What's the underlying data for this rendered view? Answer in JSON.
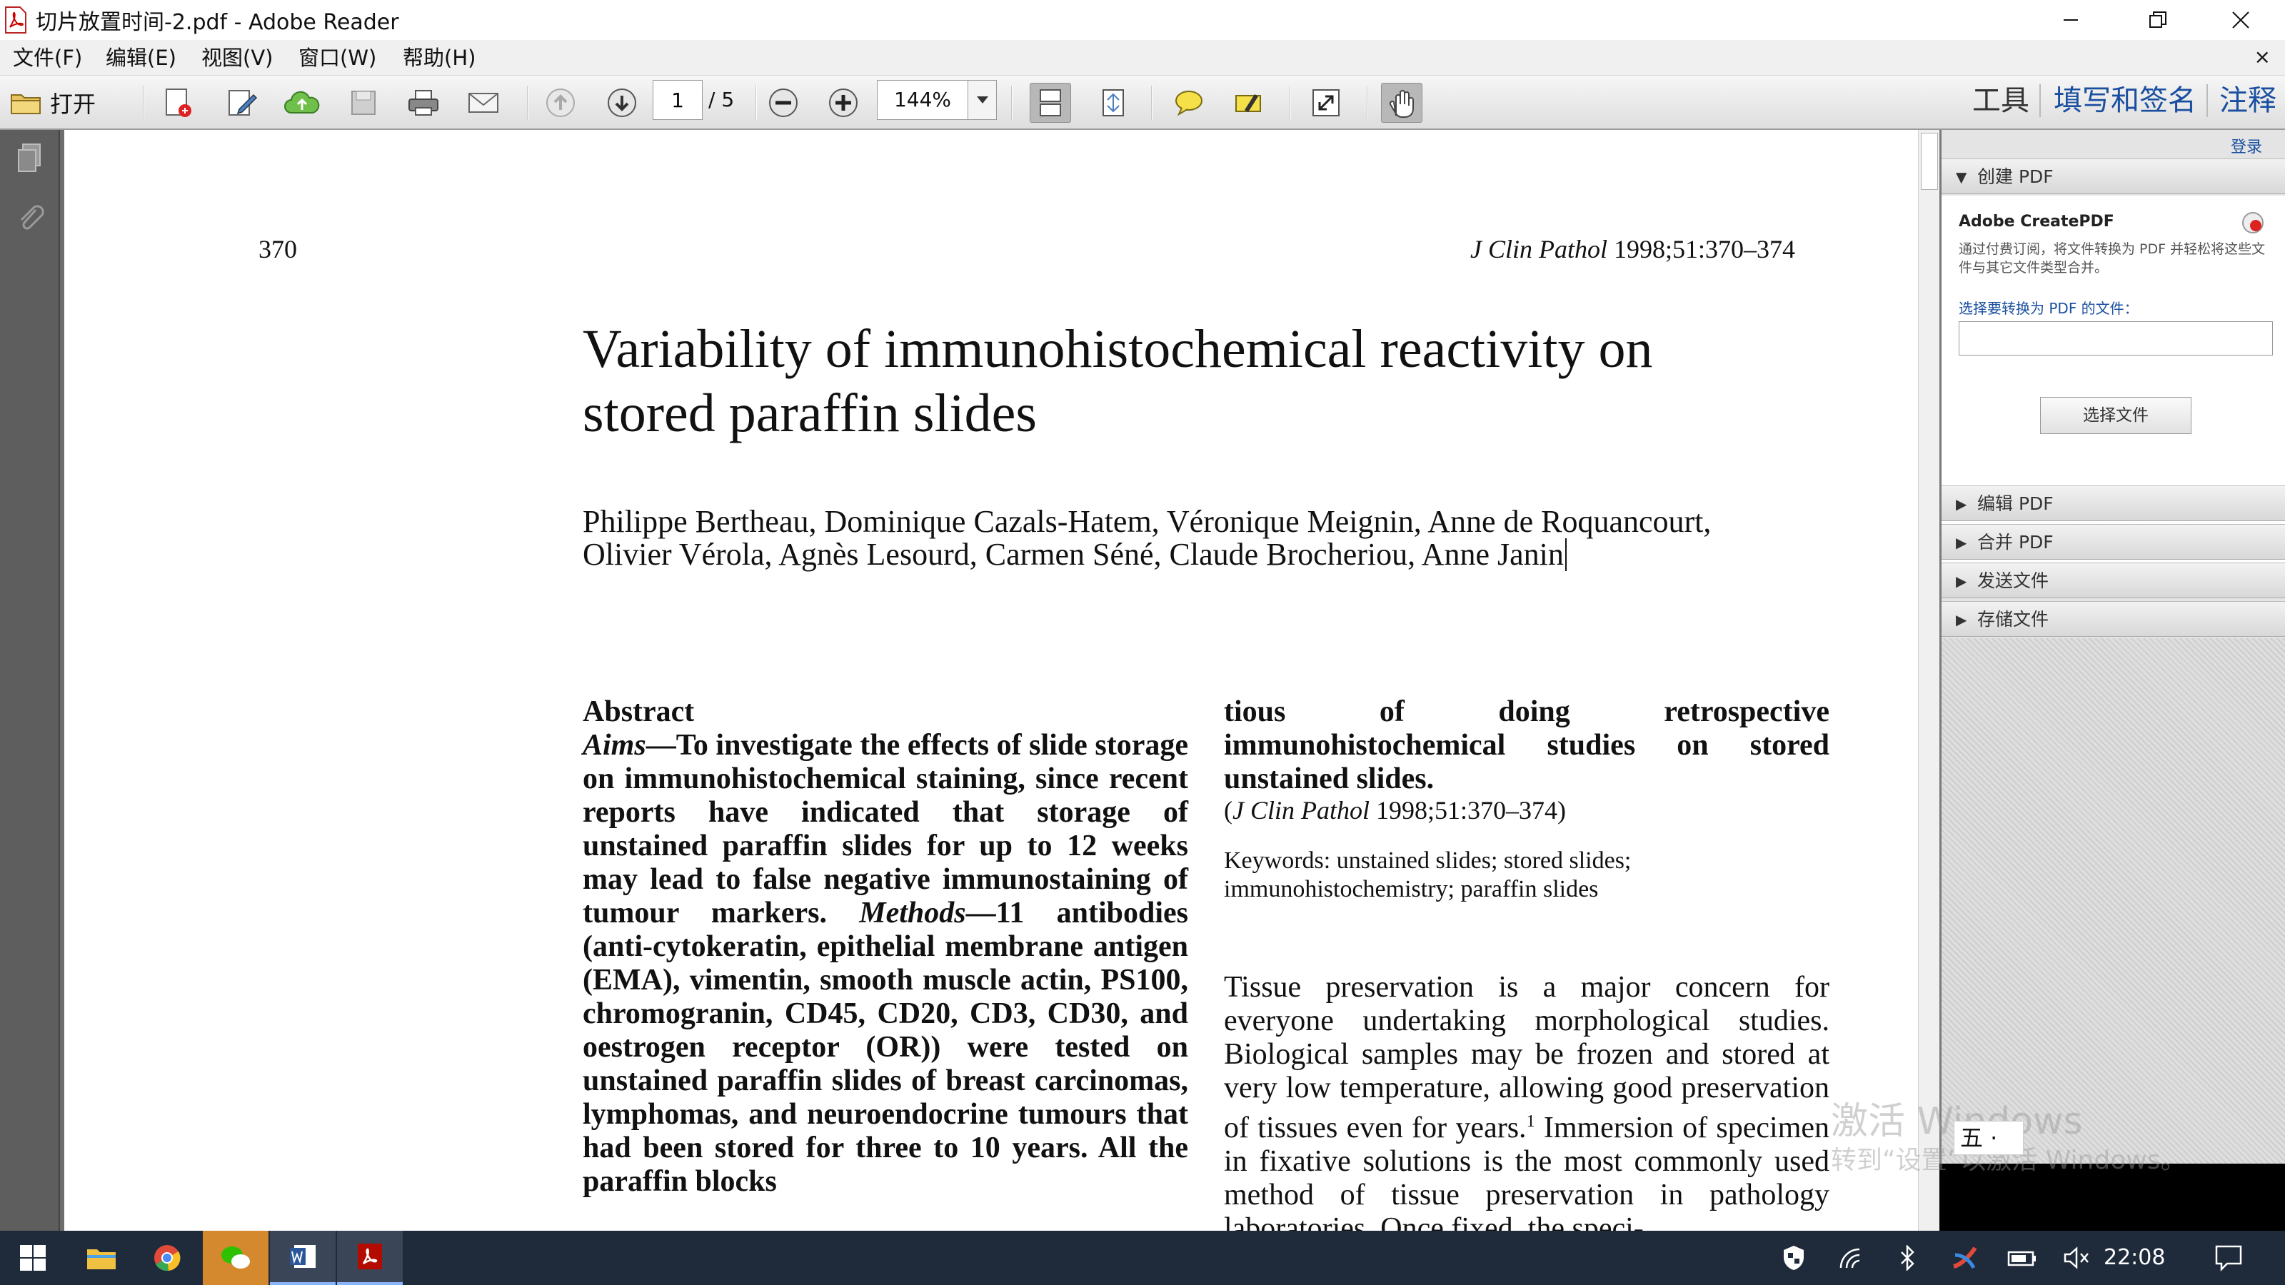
{
  "window": {
    "title": "切片放置时间-2.pdf - Adobe Reader",
    "minimize": "—",
    "restore": "❐",
    "close": "✕"
  },
  "menu": {
    "items": [
      "文件(F)",
      "编辑(E)",
      "视图(V)",
      "窗口(W)",
      "帮助(H)"
    ],
    "close_doc": "×"
  },
  "toolbar": {
    "open_label": "打开",
    "page_current": "1",
    "page_total": "/ 5",
    "zoom": "144%",
    "right_links": [
      "工具",
      "填写和签名",
      "注释"
    ]
  },
  "right_panel": {
    "login": "登录",
    "create_section": "创建 PDF",
    "acp_title": "Adobe CreatePDF",
    "acp_desc": "通过付费订阅，将文件转换为 PDF 并轻松将这些文件与其它文件类型合并。",
    "acp_label": "选择要转换为 PDF 的文件：",
    "acp_button": "选择文件",
    "sections": [
      "编辑 PDF",
      "合并 PDF",
      "发送文件",
      "存储文件"
    ]
  },
  "document": {
    "page_number": "370",
    "journal_italic": "J Clin Pathol",
    "journal_rest": " 1998;51:370–374",
    "title_line1": "Variability of immunohistochemical reactivity on",
    "title_line2": "stored paraffin slides",
    "authors_line1": "Philippe Bertheau, Dominique Cazals-Hatem, Véronique Meignin, Anne de Roquancourt,",
    "authors_line2": "Olivier Vérola, Agnès Lesourd, Carmen Séné, Claude Brocheriou, Anne Janin",
    "abstract_heading": "Abstract",
    "aims_label": "Aims",
    "aims_text": "—To investigate the effects of slide storage on immunohistochemical staining, since recent reports have indicated that storage of unstained paraffin slides for up to 12 weeks may lead to false negative immunostaining of tumour markers.",
    "methods_label": "Methods",
    "methods_text": "—11 antibodies (anti-cytokeratin, epithelial membrane antigen (EMA), vimentin, smooth muscle actin, PS100, chromogranin, CD45, CD20, CD3, CD30, and oestrogen receptor (OR)) were tested on unstained paraffin slides of breast carcinomas, lymphomas, and neuroendocrine tumours that had been stored for three to 10 years. All the paraffin blocks",
    "col2_bold": "tious of doing retrospective immunohistochemical studies on stored unstained slides.",
    "cite_open": "(",
    "cite_italic": "J Clin Pathol",
    "cite_rest": " 1998;51:370–374)",
    "keywords_line1": "Keywords: unstained slides; stored slides;",
    "keywords_line2": "immunohistochemistry; paraffin slides",
    "body_text_a": "Tissue preservation is a major concern for everyone undertaking morphological studies. Biological samples may be frozen and stored at very low temperature, allowing good preservation of tissues even for years.",
    "body_sup": "1",
    "body_text_b": " Immersion of specimen in fixative solutions is the most commonly used method of tissue preservation in pathology laboratories. Once fixed, the speci-"
  },
  "overlay": {
    "ime": "五 ·",
    "watermark_line1": "激活 Windows",
    "watermark_line2": "转到“设置”以激活 Windows。"
  },
  "taskbar": {
    "clock": "22:08"
  }
}
